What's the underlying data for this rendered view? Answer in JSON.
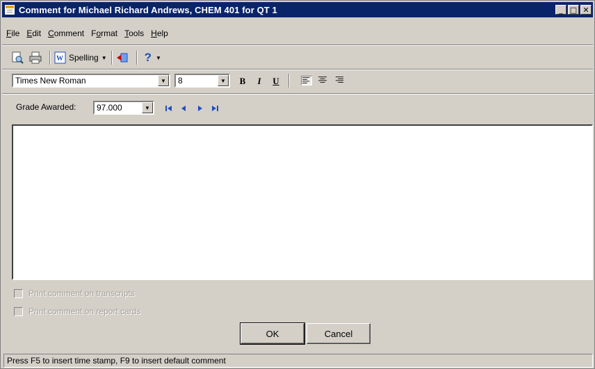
{
  "window": {
    "title": "Comment for Michael Richard Andrews, CHEM 401 for QT 1",
    "controls": {
      "minimize": "_",
      "maximize": "□",
      "close": "✕"
    }
  },
  "menu": {
    "items": [
      {
        "accel": "F",
        "rest": "ile"
      },
      {
        "accel": "E",
        "rest": "dit"
      },
      {
        "accel": "C",
        "rest": "omment"
      },
      {
        "pre": "F",
        "accel": "o",
        "rest": "rmat"
      },
      {
        "accel": "T",
        "rest": "ools"
      },
      {
        "accel": "H",
        "rest": "elp"
      }
    ]
  },
  "toolbar": {
    "spelling_label": "Spelling",
    "help_glyph": "?"
  },
  "format": {
    "font_name": "Times New Roman",
    "font_size": "8",
    "bold": "B",
    "italic": "I",
    "underline": "U"
  },
  "grade": {
    "label": "Grade Awarded:",
    "value": "97.000"
  },
  "comment_text": "",
  "options": {
    "transcripts_label": "Print comment on transcripts",
    "report_cards_label": "Print comment on report cards"
  },
  "buttons": {
    "ok": "OK",
    "cancel": "Cancel"
  },
  "status": "Press F5 to insert time stamp, F9 to insert default comment",
  "colors": {
    "titlebar": "#0a246a",
    "face": "#d4d0c8",
    "nav_arrows": "#1f4fbf"
  }
}
